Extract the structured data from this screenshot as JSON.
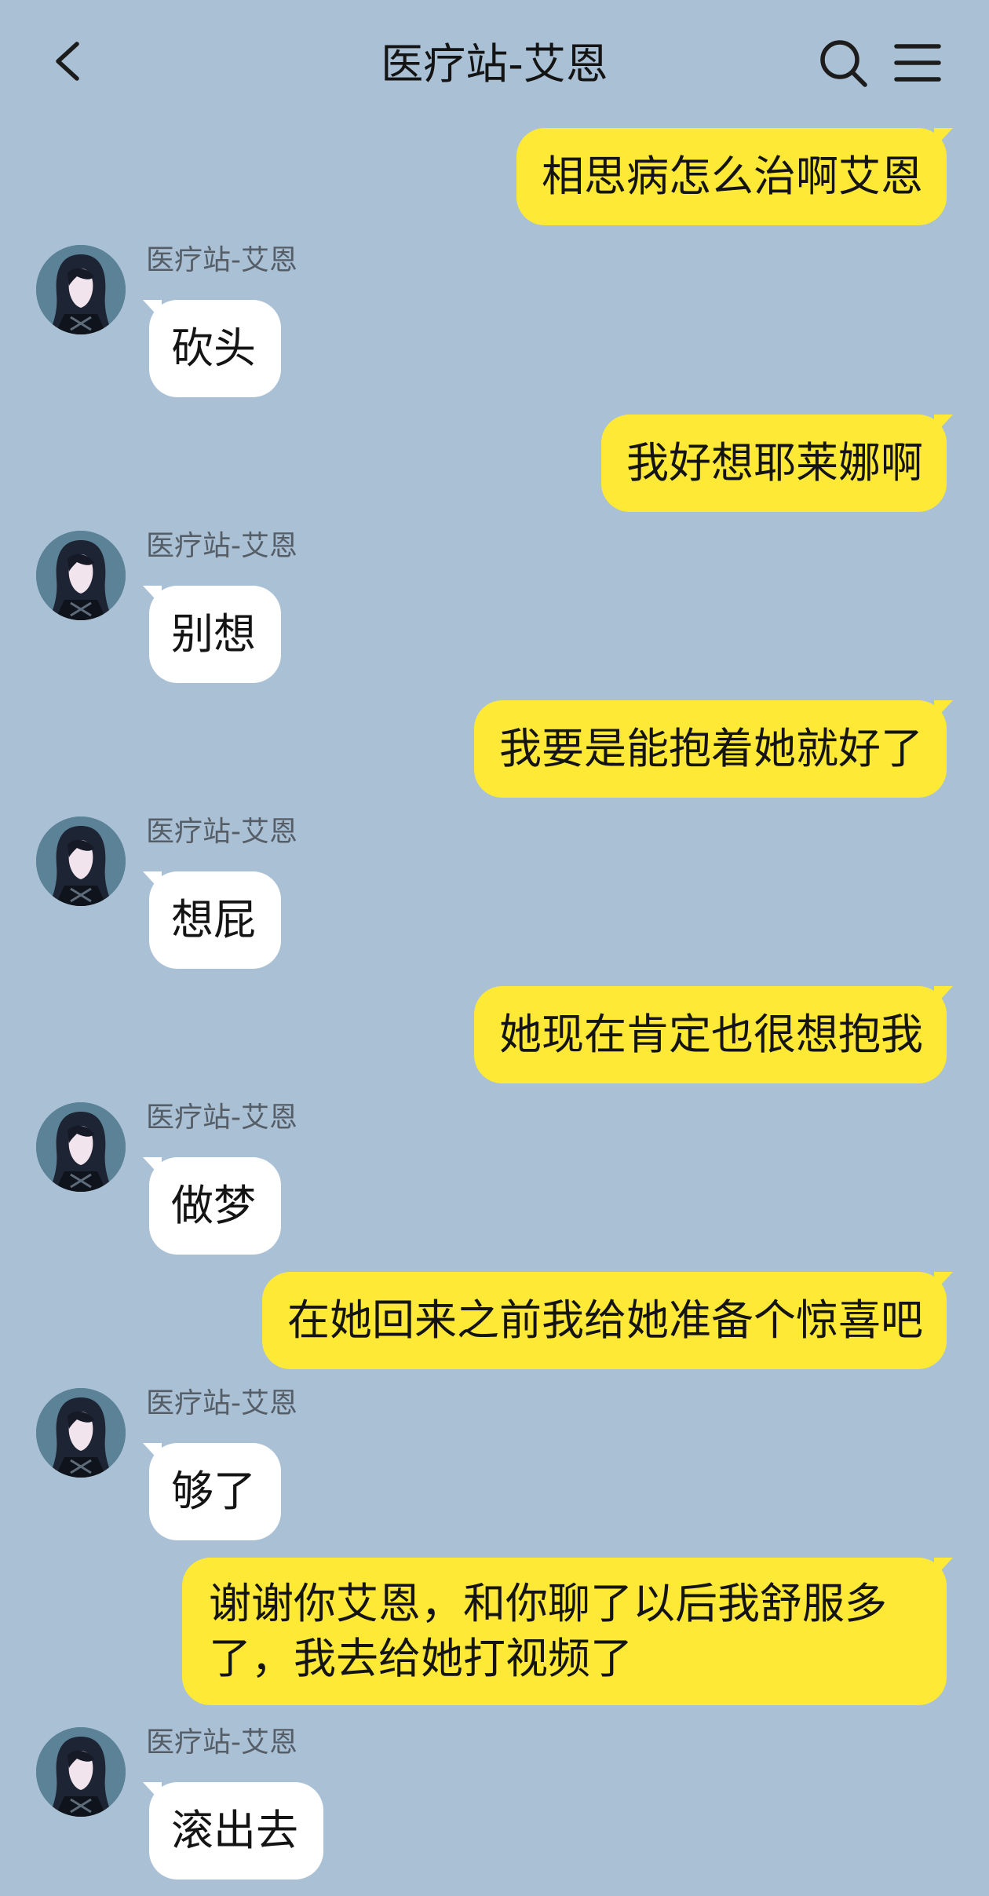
{
  "header": {
    "title": "医疗站-艾恩",
    "back_icon": "back-arrow-icon",
    "search_icon": "search-icon",
    "menu_icon": "menu-icon"
  },
  "colors": {
    "background": "#aac0d4",
    "my_bubble": "#fde936",
    "their_bubble": "#ffffff"
  },
  "contact": {
    "name": "医疗站-艾恩",
    "avatar_icon": "avatar-icon"
  },
  "messages": [
    {
      "from": "me",
      "text": "相思病怎么治啊艾恩"
    },
    {
      "from": "them",
      "sender": "医疗站-艾恩",
      "text": "砍头"
    },
    {
      "from": "me",
      "text": "我好想耶莱娜啊"
    },
    {
      "from": "them",
      "sender": "医疗站-艾恩",
      "text": "别想"
    },
    {
      "from": "me",
      "text": "我要是能抱着她就好了"
    },
    {
      "from": "them",
      "sender": "医疗站-艾恩",
      "text": "想屁"
    },
    {
      "from": "me",
      "text": "她现在肯定也很想抱我"
    },
    {
      "from": "them",
      "sender": "医疗站-艾恩",
      "text": "做梦"
    },
    {
      "from": "me",
      "text": "在她回来之前我给她准备个惊喜吧"
    },
    {
      "from": "them",
      "sender": "医疗站-艾恩",
      "text": "够了"
    },
    {
      "from": "me",
      "text": "谢谢你艾恩，和你聊了以后我舒服多了，我去给她打视频了"
    },
    {
      "from": "them",
      "sender": "医疗站-艾恩",
      "text": "滚出去"
    }
  ]
}
